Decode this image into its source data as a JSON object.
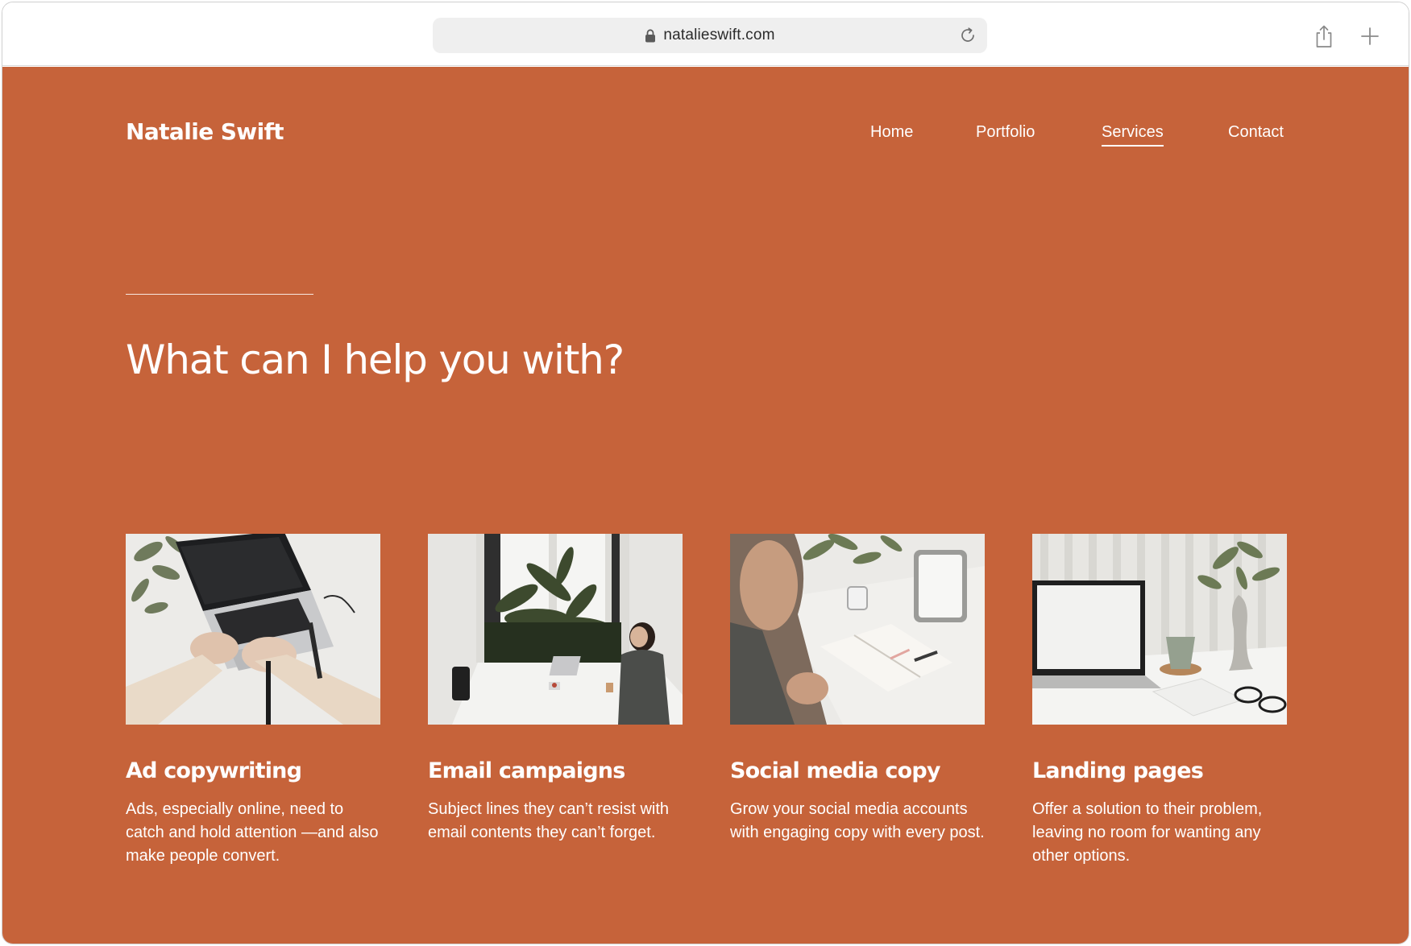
{
  "browser": {
    "url": "natalieswift.com"
  },
  "site": {
    "logo": "Natalie Swift",
    "nav": [
      {
        "label": "Home",
        "active": false
      },
      {
        "label": "Portfolio",
        "active": false
      },
      {
        "label": "Services",
        "active": true
      },
      {
        "label": "Contact",
        "active": false
      }
    ],
    "headline": "What can I help you with?",
    "services": [
      {
        "title": "Ad copywriting",
        "description": "Ads, especially online, need to catch and hold attention —and also make people convert."
      },
      {
        "title": "Email campaigns",
        "description": "Subject lines they can’t resist with email contents they can’t forget."
      },
      {
        "title": "Social media copy",
        "description": "Grow your social media accounts with engaging copy with every post."
      },
      {
        "title": "Landing pages",
        "description": "Offer a solution to their problem, leaving no room for wanting any other options."
      }
    ]
  },
  "colors": {
    "accent": "#c6633a",
    "text_on_accent": "#ffffff"
  }
}
